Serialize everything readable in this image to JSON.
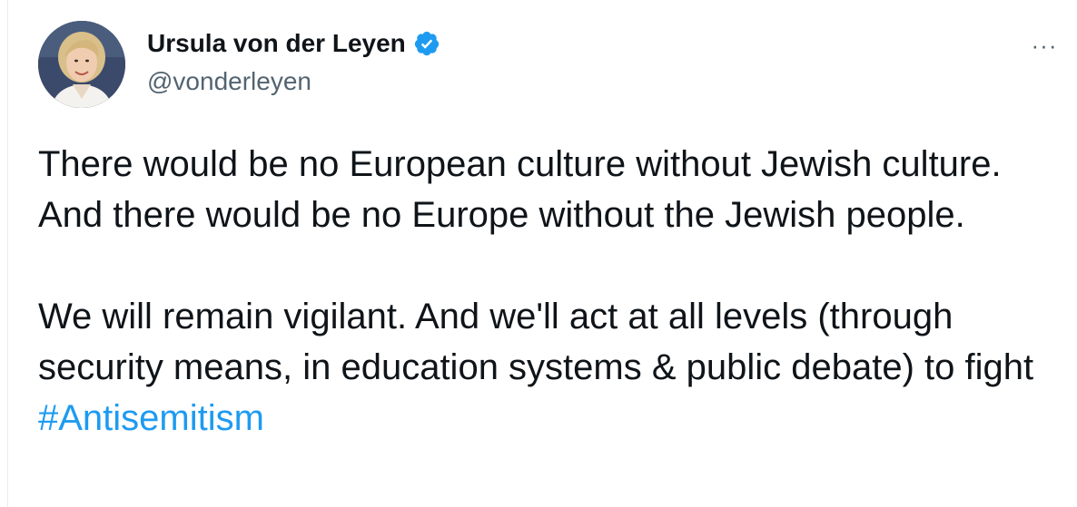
{
  "tweet": {
    "author": {
      "display_name": "Ursula von der Leyen",
      "handle": "@vonderleyen",
      "verified": true,
      "verified_icon": "verified-badge-icon"
    },
    "more_icon": "more-options-icon",
    "more_label": "···",
    "paragraph_1": "There would be no European culture without Jewish culture. And there would be no Europe without the Jewish people.",
    "paragraph_2_text": "We will remain vigilant. And we'll act at all levels (through security means, in education systems & public debate) to fight ",
    "hashtag": "#Antisemitism"
  },
  "colors": {
    "text": "#0f1419",
    "secondary": "#536471",
    "link": "#1d9bf0",
    "verified": "#1d9bf0"
  }
}
